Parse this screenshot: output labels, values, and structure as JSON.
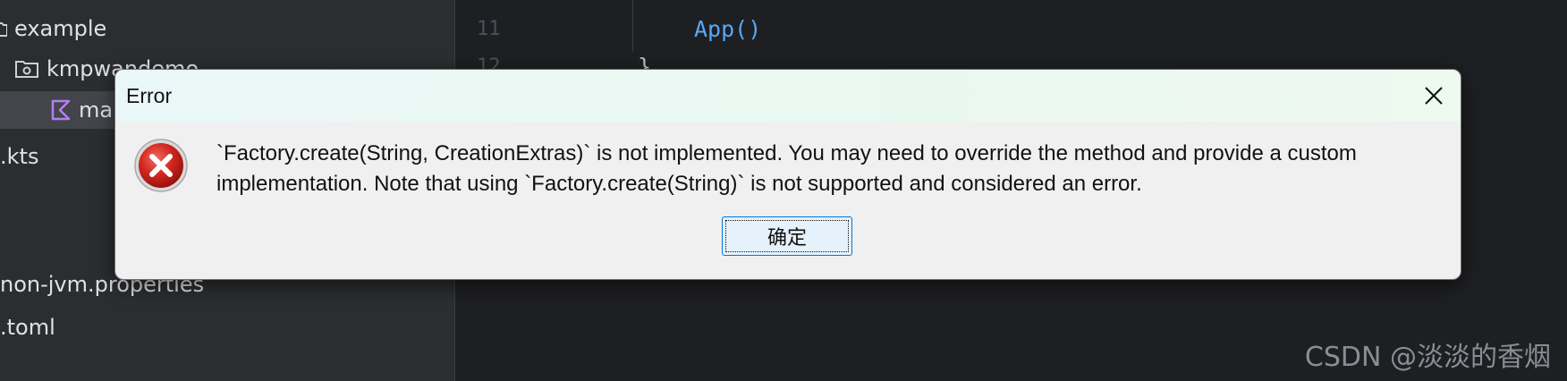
{
  "sidebar": {
    "items": [
      {
        "label": "example",
        "icon": "folder-icon"
      },
      {
        "label": "kmpwandemo",
        "icon": "package-folder-icon"
      },
      {
        "label": "main.kt",
        "icon": "kotlin-file-icon"
      },
      {
        "label": ".kts",
        "icon": "none"
      },
      {
        "label": "non-jvm.properties",
        "icon": "none"
      },
      {
        "label": ".toml",
        "icon": "none"
      }
    ]
  },
  "editor": {
    "line_numbers": [
      "11",
      "12"
    ],
    "code_line_1": "App()",
    "code_line_2": "}"
  },
  "dialog": {
    "title": "Error",
    "message": "`Factory.create(String, CreationExtras)` is not implemented. You may need to override the method and provide a custom implementation. Note that using `Factory.create(String)` is not supported and considered an error.",
    "ok_label": "确定",
    "icon": "error-icon"
  },
  "watermark": "CSDN @淡淡的香烟",
  "colors": {
    "editor_bg": "#1e1f22",
    "sidebar_bg": "#2b2d30",
    "error_red": "#c8201c",
    "button_border": "#0078d7"
  }
}
